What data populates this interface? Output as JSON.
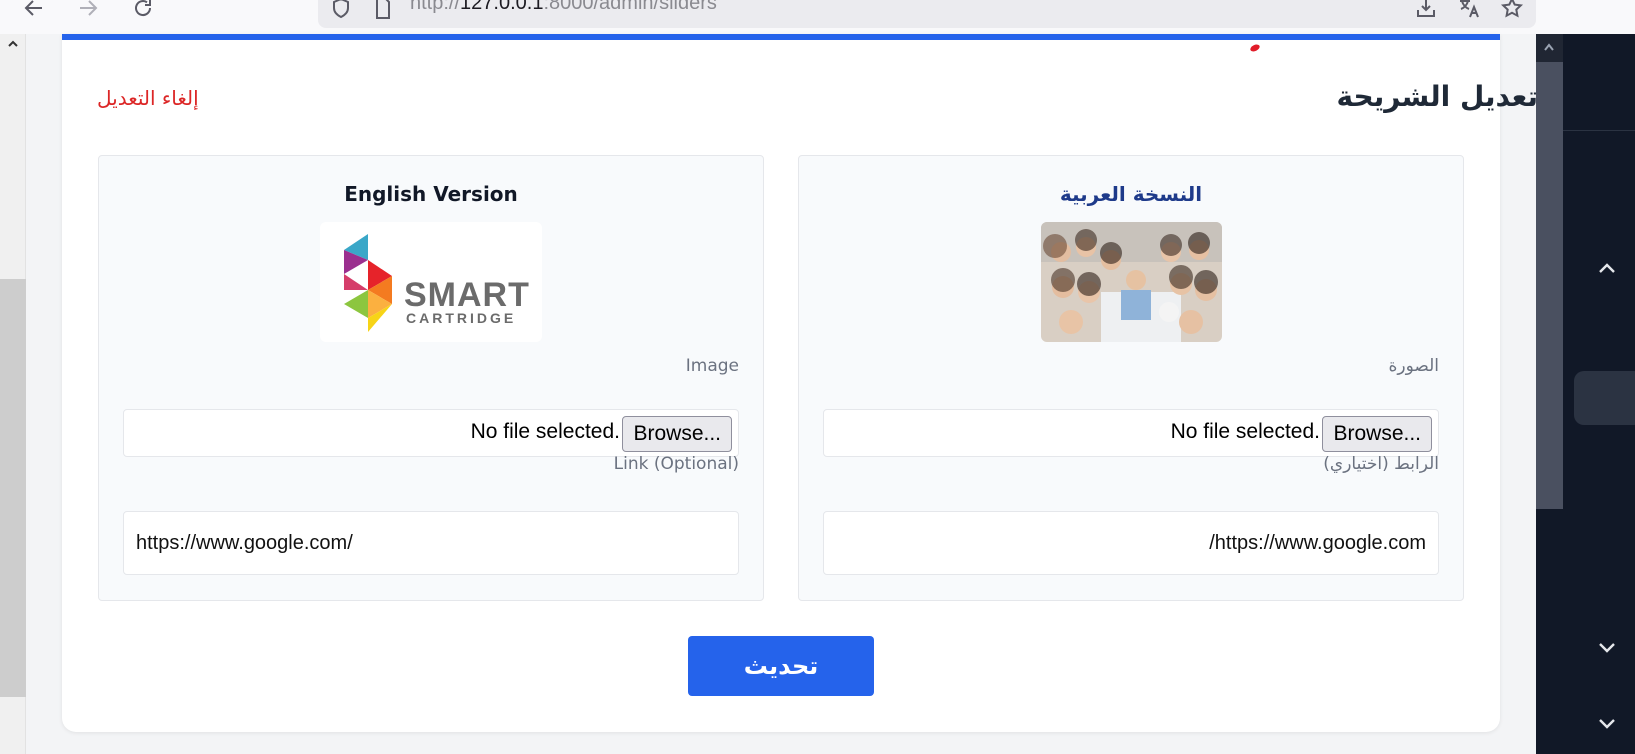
{
  "browser": {
    "url_prefix": "http://",
    "url_host": "127.0.0.1",
    "url_rest": ":8000/admin/sliders"
  },
  "card": {
    "title": "تعديل الشريحة",
    "cancel_label": "إلغاء التعديل",
    "accent_color": "#2563eb"
  },
  "arabic": {
    "title": "النسخة العربية",
    "image_label": "الصورة",
    "browse_label": "Browse...",
    "no_file_label": "No file selected.",
    "link_label": "الرابط (اختياري)",
    "link_value": "https://www.google.com/"
  },
  "english": {
    "title": "English Version",
    "logo_word": "SMART",
    "logo_sub": "CARTRIDGE",
    "image_label": "Image",
    "browse_label": "Browse...",
    "no_file_label": "No file selected.",
    "link_label": "Link (Optional)",
    "link_value": "https://www.google.com/"
  },
  "submit_label": "تحديث"
}
